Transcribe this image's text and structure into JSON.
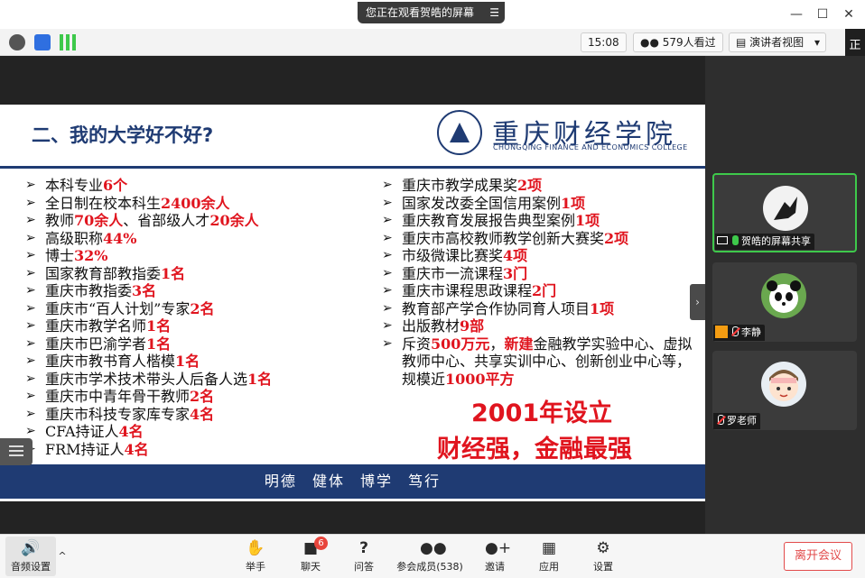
{
  "titlebar": {
    "share_notice": "您正在观看贺皓的屏幕",
    "menu_glyph": "☰",
    "minimize": "—",
    "maximize": "☐",
    "close": "✕"
  },
  "toolbar": {
    "time": "15:08",
    "viewers": "579人看过",
    "view_mode": "演讲者视图",
    "dropdown": "▾",
    "edge_tab": "正"
  },
  "slide": {
    "title": "二、我的大学好不好?",
    "college_cn": "重庆财经学院",
    "college_en": "CHONGQING FINANCE AND ECONOMICS COLLEGE",
    "bullet": "➢",
    "left_items": [
      {
        "text": "本科专业",
        "hl": "6个"
      },
      {
        "text": "全日制在校本科生",
        "hl": "2400余人"
      },
      {
        "text": "教师",
        "hl": "70余人",
        "text2": "、省部级人才",
        "hl2": "20余人"
      },
      {
        "text": "高级职称",
        "hl": "44%"
      },
      {
        "text": "博士",
        "hl": "32%"
      },
      {
        "text": "国家教育部教指委",
        "hl": "1名"
      },
      {
        "text": "重庆市教指委",
        "hl": "3名"
      },
      {
        "text": "重庆市“百人计划”专家",
        "hl": "2名"
      },
      {
        "text": "重庆市教学名师",
        "hl": "1名"
      },
      {
        "text": "重庆市巴渝学者",
        "hl": "1名"
      },
      {
        "text": "重庆市教书育人楷模",
        "hl": "1名"
      },
      {
        "text": "重庆市学术技术带头人后备人选",
        "hl": "1名"
      },
      {
        "text": "重庆市中青年骨干教师",
        "hl": "2名"
      },
      {
        "text": "重庆市科技专家库专家",
        "hl": "4名"
      },
      {
        "text": "CFA持证人",
        "hl": "4名"
      },
      {
        "text": "FRM持证人",
        "hl": "4名"
      }
    ],
    "right_items": [
      {
        "text": "重庆市教学成果奖",
        "hl": "2项"
      },
      {
        "text": "国家发改委全国信用案例",
        "hl": "1项"
      },
      {
        "text": "重庆教育发展报告典型案例",
        "hl": "1项"
      },
      {
        "text": "重庆市高校教师教学创新大赛奖",
        "hl": "2项"
      },
      {
        "text": "市级微课比赛奖",
        "hl": "4项"
      },
      {
        "text": "重庆市一流课程",
        "hl": "3门"
      },
      {
        "text": "重庆市课程思政课程",
        "hl": "2门"
      },
      {
        "text": "教育部产学合作协同育人项目",
        "hl": "1项"
      },
      {
        "text": "出版教材",
        "hl": "9部"
      }
    ],
    "invest": {
      "a": "斥资",
      "b": "500万元",
      "c": "，",
      "d": "新建",
      "e": "金融教学实验中心、虚拟教师中心、共享实训中心、创新创业中心等，规模近",
      "f": "1000平方"
    },
    "highlight1": "2001年设立",
    "highlight2": "财经强，金融最强",
    "motto": "明德 健体 博学 笃行"
  },
  "participants": [
    {
      "name": "贺皓的屏幕共享",
      "mic": "on",
      "sharing": true
    },
    {
      "name": "李静",
      "mic": "off",
      "sharing": false
    },
    {
      "name": "罗老师",
      "mic": "off",
      "sharing": false
    }
  ],
  "controls": {
    "audio": "音频设置",
    "expand": "^",
    "raise_hand": "举手",
    "chat": "聊天",
    "chat_badge": "6",
    "qa": "问答",
    "members": "参会成员(538)",
    "invite": "邀请",
    "apps": "应用",
    "settings": "设置",
    "leave": "离开会议"
  },
  "colors": {
    "navy": "#1f3b73",
    "red": "#e0141e",
    "active_green": "#3ec94b",
    "leave_red": "#e24b4b"
  }
}
